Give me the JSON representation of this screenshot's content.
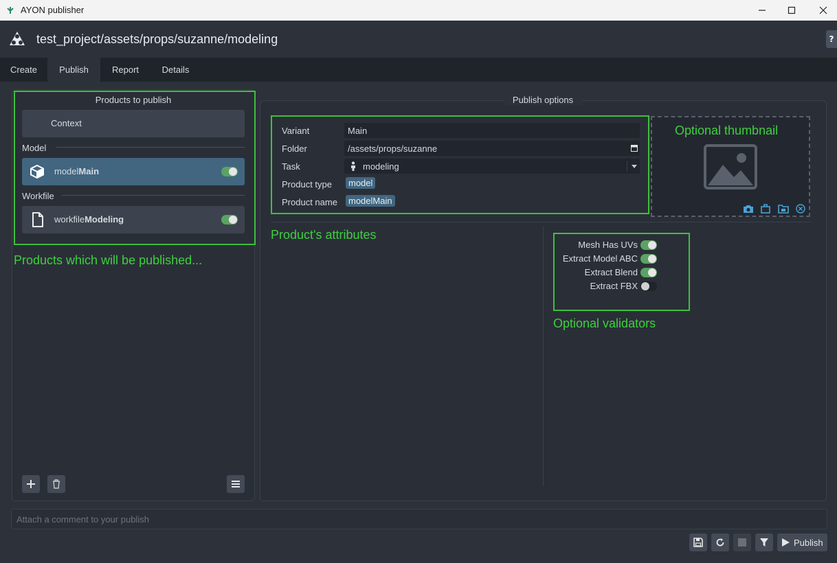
{
  "window": {
    "title": "AYON publisher"
  },
  "header": {
    "context_path": "test_project/assets/props/suzanne/modeling",
    "help_label": "?"
  },
  "tabs": [
    {
      "label": "Create"
    },
    {
      "label": "Publish"
    },
    {
      "label": "Report"
    },
    {
      "label": "Details"
    }
  ],
  "active_tab": "Publish",
  "products_panel": {
    "title": "Products to publish",
    "context_label": "Context",
    "groups": [
      {
        "name": "Model",
        "items": [
          {
            "prefix": "model",
            "bold": "Main",
            "icon": "cube-icon",
            "enabled": true,
            "selected": true
          }
        ]
      },
      {
        "name": "Workfile",
        "items": [
          {
            "prefix": "workfile",
            "bold": "Modeling",
            "icon": "file-icon",
            "enabled": true,
            "selected": false
          }
        ]
      }
    ],
    "annotation": "Products which will be published..."
  },
  "publish_options": {
    "title": "Publish options",
    "fields": {
      "variant_label": "Variant",
      "variant_value": "Main",
      "folder_label": "Folder",
      "folder_value": "/assets/props/suzanne",
      "task_label": "Task",
      "task_value": "modeling",
      "product_type_label": "Product type",
      "product_type_value": "model",
      "product_name_label": "Product name",
      "product_name_value": "modelMain"
    },
    "thumbnail_annotation": "Optional thumbnail",
    "attributes_annotation": "Product's attributes",
    "validators_annotation": "Optional validators",
    "validators": [
      {
        "label": "Mesh Has UVs",
        "enabled": true
      },
      {
        "label": "Extract Model ABC",
        "enabled": true
      },
      {
        "label": "Extract Blend",
        "enabled": true
      },
      {
        "label": "Extract FBX",
        "enabled": false
      }
    ]
  },
  "comment": {
    "placeholder": "Attach a comment to your publish"
  },
  "footer": {
    "publish_label": "Publish"
  },
  "colors": {
    "accent_green": "#3fbf3f",
    "selected_blue": "#426680",
    "background": "#2c313a"
  }
}
